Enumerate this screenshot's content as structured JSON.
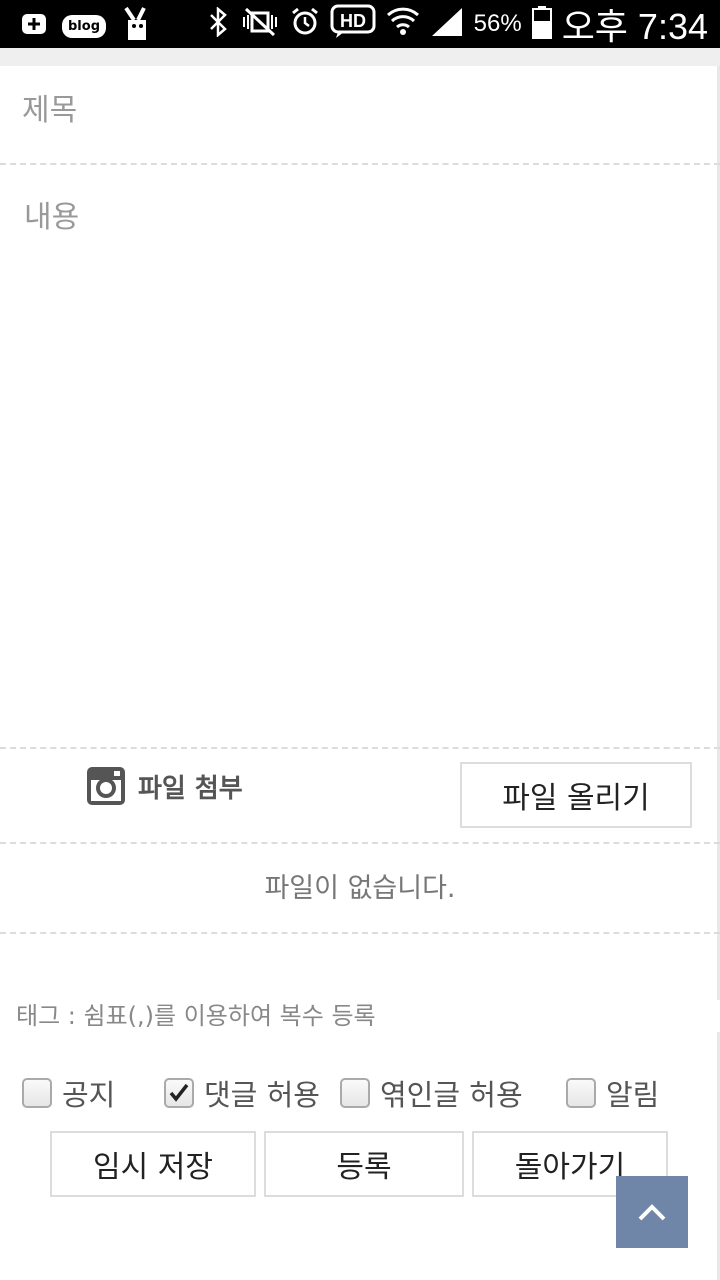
{
  "status_bar": {
    "blog_badge": "blog",
    "battery_percent": "56%",
    "time": "오후 7:34",
    "hd_badge": "HD"
  },
  "form": {
    "title_placeholder": "제목",
    "content_placeholder": "내용",
    "attach_label": "파일 첨부",
    "upload_button": "파일 올리기",
    "no_file_text": "파일이 없습니다.",
    "tag_placeholder": "태그 : 쉼표(,)를 이용하여 복수 등록"
  },
  "options": [
    {
      "label": "공지",
      "checked": false
    },
    {
      "label": "댓글 허용",
      "checked": true
    },
    {
      "label": "엮인글 허용",
      "checked": false
    },
    {
      "label": "알림",
      "checked": false
    }
  ],
  "actions": {
    "temp_save": "임시 저장",
    "submit": "등록",
    "back": "돌아가기"
  },
  "colors": {
    "scroll_top_bg": "#6f86a8",
    "border": "#dcdcdc"
  }
}
